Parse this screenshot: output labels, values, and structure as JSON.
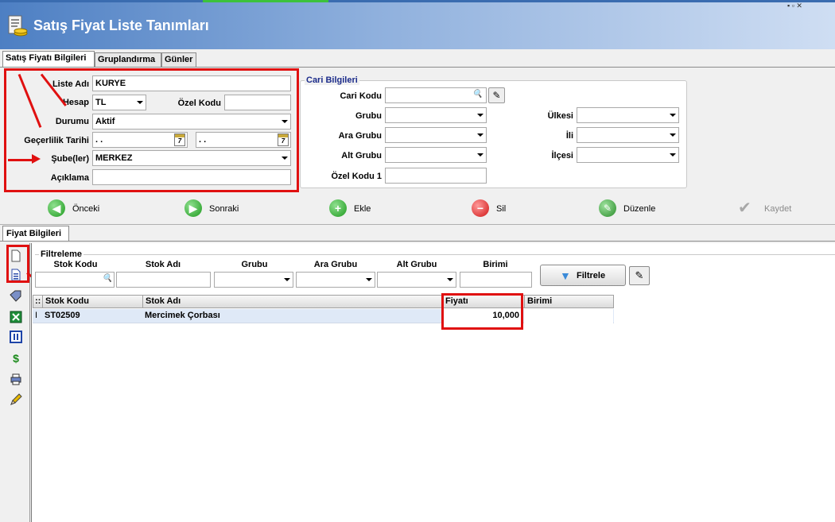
{
  "window": {
    "title": "Satış Fiyat Liste Tanımları"
  },
  "tabs": [
    "Satış Fiyatı Bilgileri",
    "Gruplandırma",
    "Günler"
  ],
  "form": {
    "liste_adi": {
      "label": "Liste Adı",
      "value": "KURYE"
    },
    "hesap": {
      "label": "Hesap",
      "value": "TL"
    },
    "ozel_kodu": {
      "label": "Özel Kodu",
      "value": ""
    },
    "durumu": {
      "label": "Durumu",
      "value": "Aktif"
    },
    "gecerlilik": {
      "label": "Geçerlilik Tarihi",
      "start": ". .",
      "end": ". ."
    },
    "subeler": {
      "label": "Şube(ler)",
      "value": "MERKEZ"
    },
    "aciklama": {
      "label": "Açıklama",
      "value": ""
    }
  },
  "cari": {
    "title": "Cari Bilgileri",
    "cari_kodu": "Cari Kodu",
    "grubu": "Grubu",
    "ara_grubu": "Ara Grubu",
    "alt_grubu": "Alt Grubu",
    "ozel_kodu_1": "Özel Kodu 1",
    "ulkesi": "Ülkesi",
    "ili": "İli",
    "ilcesi": "İlçesi"
  },
  "toolbar": {
    "onceki": "Önceki",
    "sonraki": "Sonraki",
    "ekle": "Ekle",
    "sil": "Sil",
    "duzenle": "Düzenle",
    "kaydet": "Kaydet"
  },
  "fiyat_tab": "Fiyat Bilgileri",
  "filter": {
    "title": "Filtreleme",
    "stok_kodu": "Stok Kodu",
    "stok_adi": "Stok Adı",
    "grubu": "Grubu",
    "ara_grubu": "Ara Grubu",
    "alt_grubu": "Alt Grubu",
    "birimi": "Birimi",
    "button": "Filtrele"
  },
  "grid": {
    "columns": [
      "Stok Kodu",
      "Stok Adı",
      "Fiyatı",
      "Birimi"
    ],
    "rows": [
      {
        "stok_kodu": "ST02509",
        "stok_adi": "Mercimek Çorbası",
        "fiyati": "10,000",
        "birimi": ""
      }
    ]
  },
  "colors": {
    "annotation": "#e01010",
    "title_gradient_start": "#4d7fc3",
    "row_selected": "#dfe9f7"
  }
}
